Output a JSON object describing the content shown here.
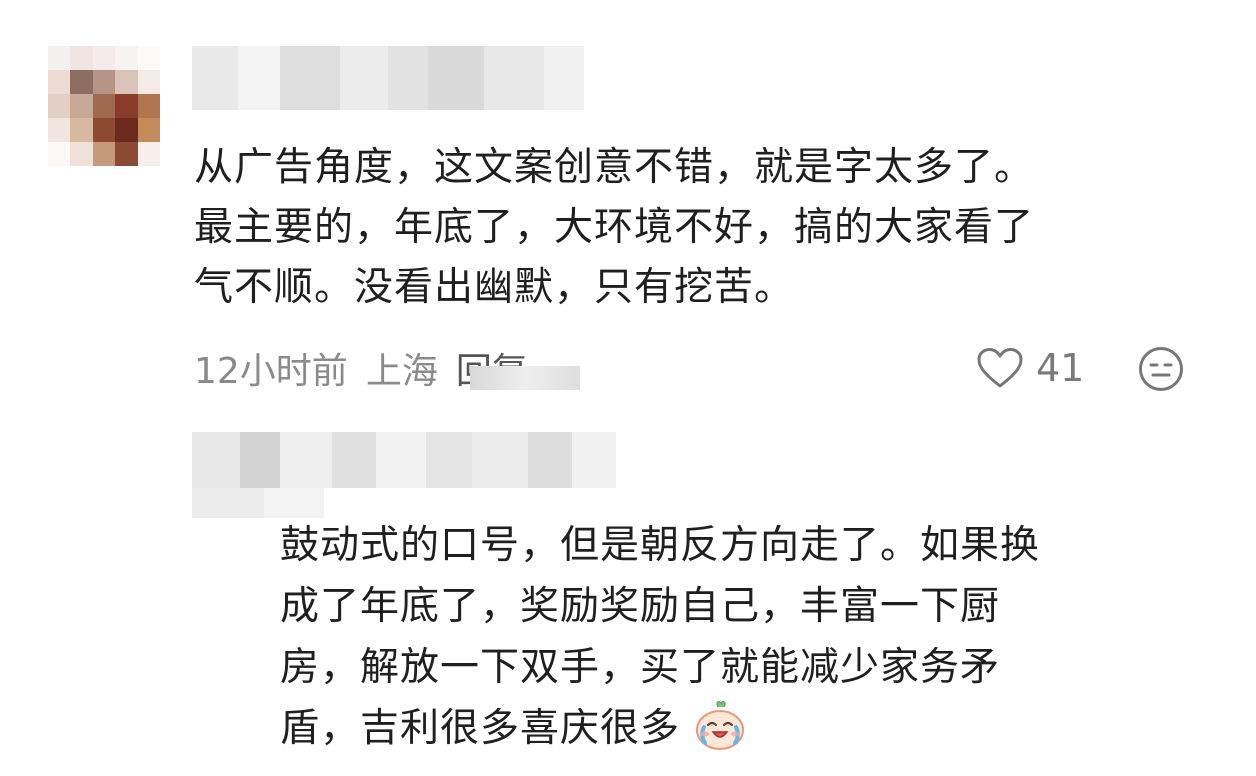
{
  "comment": {
    "text_lines": [
      "从广告角度，这文案创意不错，就是字太多了。",
      "最主要的，年底了，大环境不好，搞的大家看了",
      "气不顺。没看出幽默，只有挖苦。"
    ],
    "time": "12小时前",
    "location": "上海",
    "reply_label": "回复",
    "like_count": "41",
    "icons": [
      "heart-icon",
      "emoji-icon"
    ]
  },
  "reply": {
    "text_lines": [
      "鼓动式的口号，但是朝反方向走了。如果换",
      "成了年底了，奖励奖励自己，丰富一下厨",
      "房，解放一下双手，买了就能减少家务矛",
      "盾，吉利很多喜庆很多"
    ],
    "sticker": "crying-laughing-sticker"
  },
  "colors": {
    "text": "#1f1f1f",
    "meta": "#8a8a8a",
    "icon": "#777777"
  }
}
